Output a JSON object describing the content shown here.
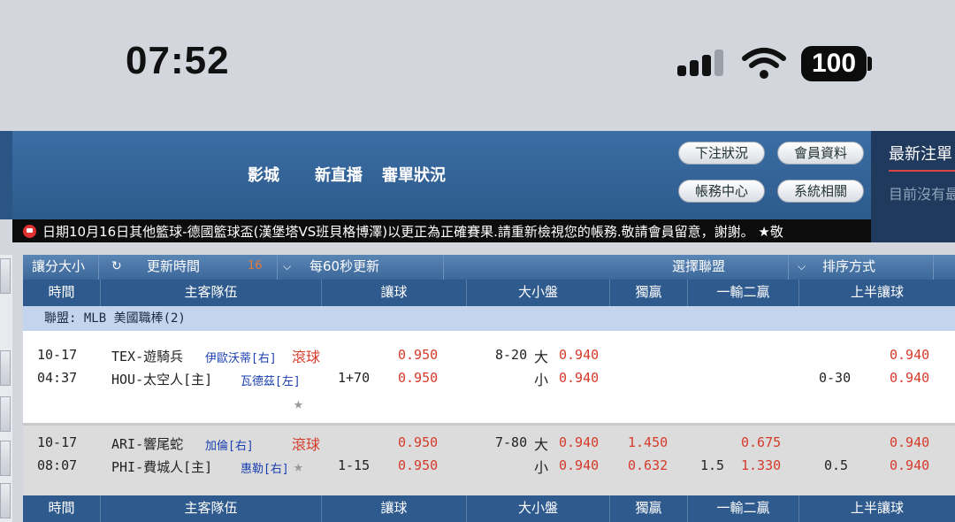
{
  "status": {
    "time": "07:52",
    "battery": "100"
  },
  "header": {
    "nav": [
      "影城",
      "新直播",
      "審單狀況"
    ],
    "buttons": {
      "bet_status": "下注狀況",
      "member_info": "會員資料",
      "account_center": "帳務中心",
      "system": "系統相關"
    },
    "side_title": "最新注單",
    "side_empty": "目前沒有最"
  },
  "marquee": {
    "text": "日期10月16日其他籃球-德國籃球盃(漢堡塔VS班貝格博澤)以更正為正確賽果.請重新檢視您的帳務.敬請會員留意，謝謝。 ★敬"
  },
  "toolbar": {
    "handicap": "讓分大小",
    "refresh_label": "更新時間",
    "refresh_count": "16",
    "interval": "每60秒更新",
    "select_league": "選擇聯盟",
    "sort": "排序方式"
  },
  "columns": [
    "時間",
    "主客隊伍",
    "讓球",
    "大小盤",
    "獨贏",
    "一輸二贏",
    "上半讓球"
  ],
  "league": "聯盟: MLB 美國職棒(2)",
  "matches": [
    {
      "date": "10-17",
      "time": "04:37",
      "away": "TEX-遊騎兵",
      "away_pitcher": "伊歐沃蒂[右]",
      "home": "HOU-太空人[主]",
      "home_pitcher": "瓦德茲[左]",
      "live": "滾球",
      "hdp_line": "1+70",
      "hdp_odds": [
        "0.950",
        "0.950"
      ],
      "ou_line": "8-20",
      "ou_over": "大",
      "ou_under": "小",
      "ou_odds": [
        "0.940",
        "0.940"
      ],
      "ml_odds": [
        "",
        ""
      ],
      "ml2_line": "",
      "ml2_odds": [
        "",
        ""
      ],
      "h1_line": "0-30",
      "h1_odds": [
        "0.940",
        "0.940"
      ]
    },
    {
      "date": "10-17",
      "time": "08:07",
      "away": "ARI-響尾蛇",
      "away_pitcher": "加倫[右]",
      "home": "PHI-費城人[主]",
      "home_pitcher": "惠勒[右]",
      "live": "滾球",
      "hdp_line": "1-15",
      "hdp_odds": [
        "0.950",
        "0.950"
      ],
      "ou_line": "7-80",
      "ou_over": "大",
      "ou_under": "小",
      "ou_odds": [
        "0.940",
        "0.940"
      ],
      "ml_odds": [
        "1.450",
        "0.632"
      ],
      "ml2_line": "1.5",
      "ml2_odds": [
        "0.675",
        "1.330"
      ],
      "h1_line": "0.5",
      "h1_odds": [
        "0.940",
        "0.940"
      ]
    }
  ],
  "colors": {
    "header_blue": "#2f5a8e",
    "odds_red": "#d63a2a",
    "league_bg": "#c3d4ec"
  }
}
